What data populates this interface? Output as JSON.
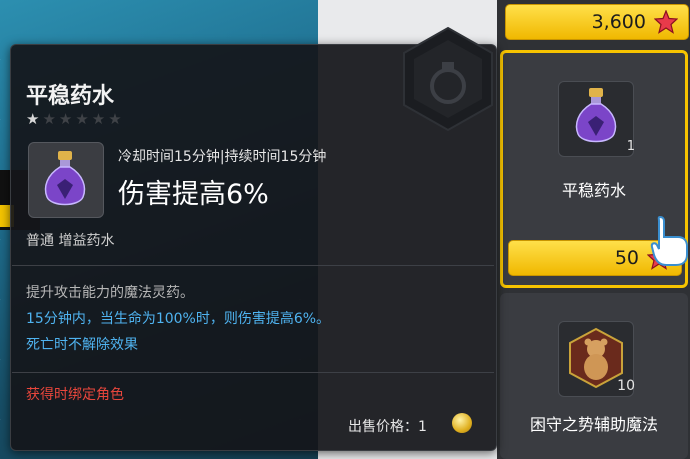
{
  "tooltip": {
    "title": "平稳药水",
    "star_filled": "★",
    "stars_empty": "★★★★★",
    "cooldown": "冷却时间15分钟|持续时间15分钟",
    "effect": "伤害提高6%",
    "type": "普通 增益药水",
    "description": "提升攻击能力的魔法灵药。",
    "detail_line1": "15分钟内，当生命为100%时，则伤害提高6%。",
    "detail_line2": "死亡时不解除效果",
    "bind_notice": "获得时绑定角色",
    "sell_price": "出售价格：1",
    "item_icon": "purple-potion-icon"
  },
  "shop": {
    "top_price": "3,600",
    "selected_item": {
      "name": "平稳药水",
      "count": "1",
      "price": "50",
      "icon": "purple-potion-icon"
    },
    "next_item": {
      "name": "困守之势辅助魔法",
      "count": "10",
      "icon": "teddy-bear-buff-icon"
    }
  },
  "colors": {
    "accent_yellow": "#f7c400",
    "skill_blue": "#4fb3f0",
    "warning_red": "#e8463c",
    "tooltip_bg": "#14161a"
  }
}
